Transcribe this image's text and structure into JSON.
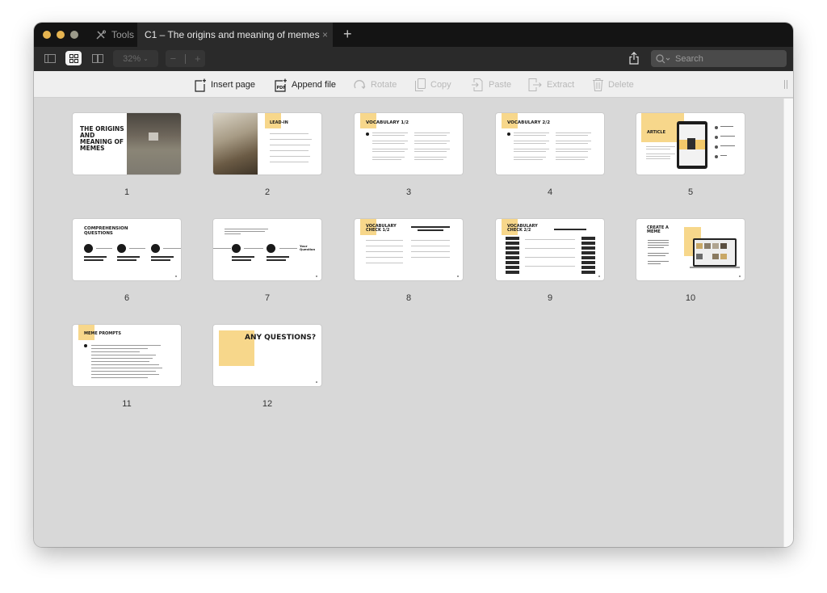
{
  "window": {
    "traffic_lights": [
      "#e6b450",
      "#e6b450",
      "#9b9a8a"
    ],
    "tabs": [
      {
        "label": "Tools",
        "icon": "tools-icon",
        "active": false
      },
      {
        "label": "C1 – The origins and meaning of memes",
        "active": true
      }
    ],
    "close_tab_glyph": "×",
    "new_tab_glyph": "+"
  },
  "toolbar": {
    "view_modes": [
      "sidebar-view",
      "grid-view",
      "two-page-view"
    ],
    "active_view": "grid-view",
    "zoom_level": "32%",
    "zoom_out_glyph": "−",
    "zoom_in_glyph": "+",
    "search_placeholder": "Search"
  },
  "editbar": {
    "items": [
      {
        "label": "Insert page",
        "icon": "insert-page-icon",
        "enabled": true
      },
      {
        "label": "Append file",
        "icon": "append-pdf-icon",
        "enabled": true
      },
      {
        "label": "Rotate",
        "icon": "rotate-icon",
        "enabled": false
      },
      {
        "label": "Copy",
        "icon": "copy-icon",
        "enabled": false
      },
      {
        "label": "Paste",
        "icon": "paste-icon",
        "enabled": false
      },
      {
        "label": "Extract",
        "icon": "extract-icon",
        "enabled": false
      },
      {
        "label": "Delete",
        "icon": "trash-icon",
        "enabled": false
      }
    ]
  },
  "accent_color": "#f7d78b",
  "pages": [
    {
      "number": "1",
      "title": "THE ORIGINS AND MEANING OF MEMES"
    },
    {
      "number": "2",
      "title": "LEAD-IN"
    },
    {
      "number": "3",
      "title": "VOCABULARY 1/2"
    },
    {
      "number": "4",
      "title": "VOCABULARY 2/2"
    },
    {
      "number": "5",
      "title": "ARTICLE"
    },
    {
      "number": "6",
      "title": "COMPREHENSION QUESTIONS"
    },
    {
      "number": "7",
      "title": "Your Question"
    },
    {
      "number": "8",
      "title": "VOCABULARY CHECK 1/2"
    },
    {
      "number": "9",
      "title": "VOCABULARY CHECK 2/2"
    },
    {
      "number": "10",
      "title": "CREATE A MEME"
    },
    {
      "number": "11",
      "title": "MEME PROMPTS"
    },
    {
      "number": "12",
      "title": "ANY QUESTIONS?"
    }
  ]
}
